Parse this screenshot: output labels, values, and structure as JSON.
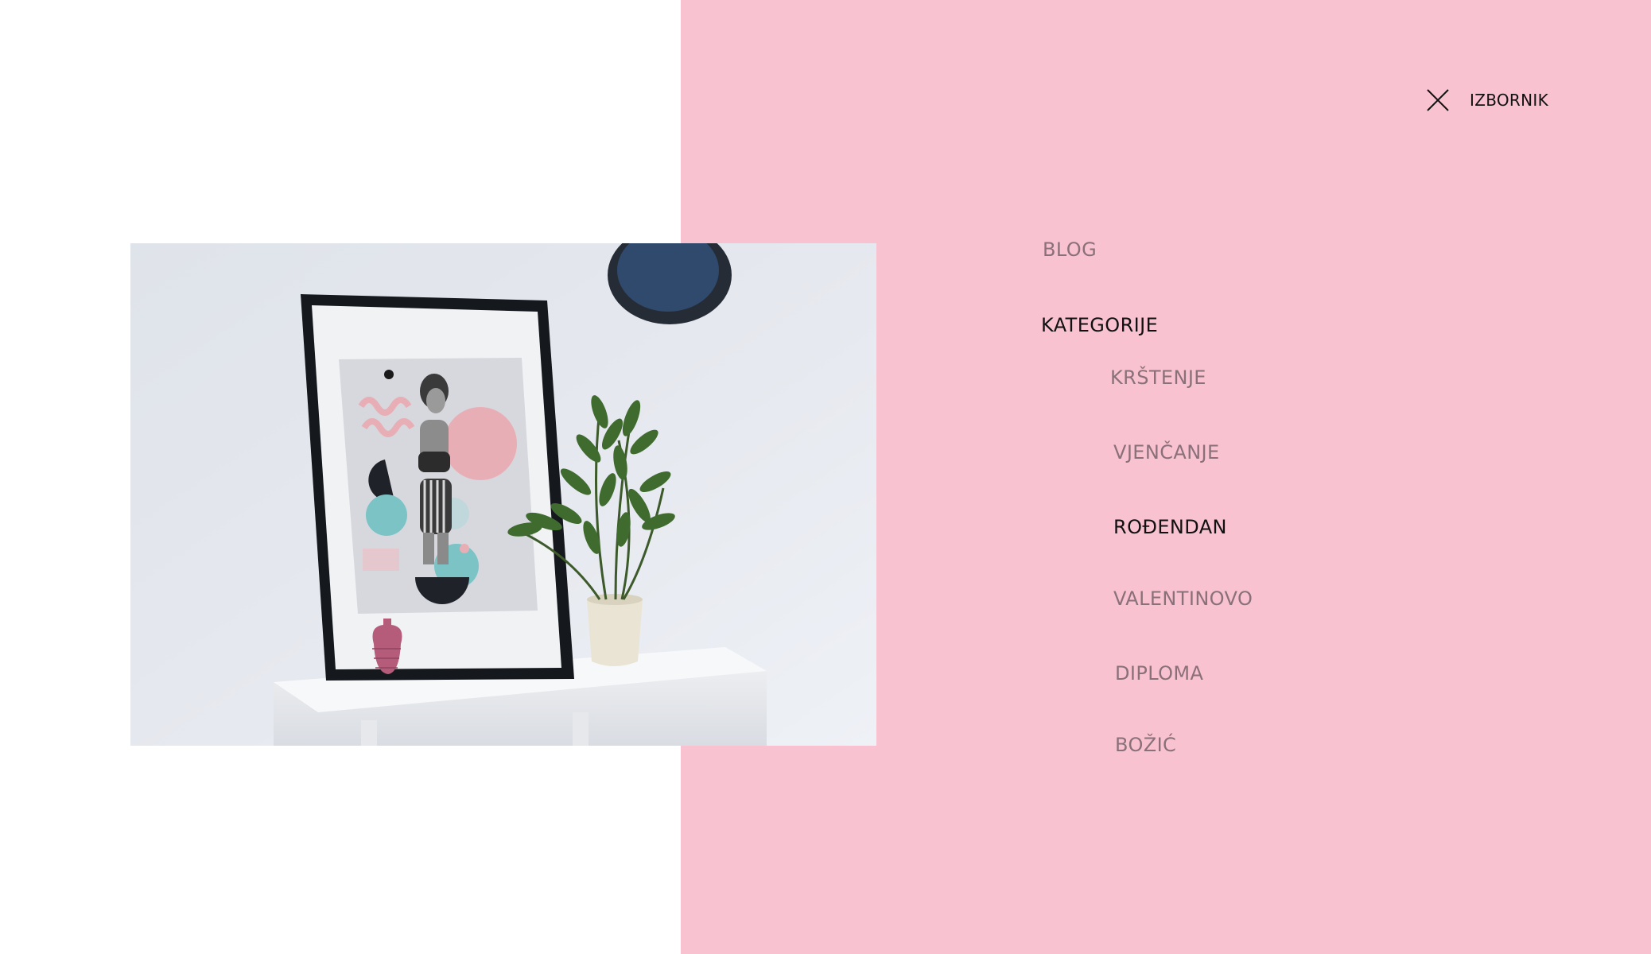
{
  "header": {
    "menu_label": "IZBORNIK",
    "close_icon": "close-icon"
  },
  "nav": {
    "blog": "BLOG",
    "kategorije": "KATEGORIJE",
    "categories": [
      "KRŠTENJE",
      "VJENČANJE",
      "ROĐENDAN",
      "VALENTINOVO",
      "DIPLOMA",
      "BOŽIĆ"
    ],
    "active_category": "ROĐENDAN"
  },
  "colors": {
    "pink_panel": "#f8c2d1",
    "nav_text": "#8a7078",
    "active_text": "#111111",
    "background": "#ffffff"
  }
}
